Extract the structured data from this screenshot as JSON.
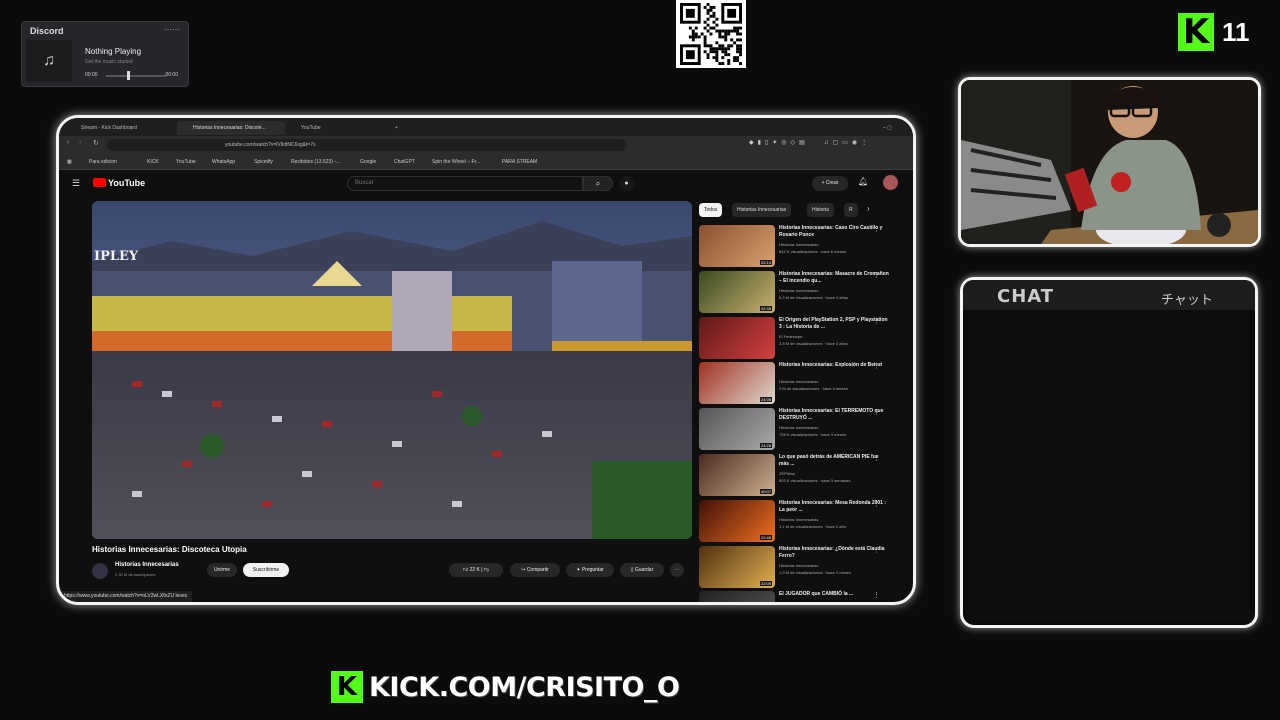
{
  "discord": {
    "title": "Discord",
    "now_playing": "Nothing Playing",
    "subtitle": "Get the music started",
    "time_current": "00:00",
    "time_total": "00:00",
    "progress": 0
  },
  "kick_badge": {
    "letter": "K",
    "count": "11"
  },
  "browser": {
    "tabs": [
      "Stream - Kick Dashboard",
      "Historias Innecesarias: Discote...",
      "YouTube"
    ],
    "url": "youtube.com/watch?v=lVIkttNC6sg&t=7s",
    "bookmarks": [
      "Para edicion",
      "KICK",
      "YouTube",
      "WhatsApp",
      "Spicetify",
      "Recibidos (13.523) -...",
      "Google",
      "ChatGPT",
      "Spin the Wheel – Fr...",
      "PARA STREAM"
    ]
  },
  "youtube": {
    "logo": "YouTube",
    "search_placeholder": "Buscar",
    "create_label": "Crear",
    "video_title": "Historias Innecesarias: Discoteca Utopia",
    "video_overlay_text": "IPLEY",
    "channel_name": "Historias Innecesarias",
    "channel_subs": "2,32 M de suscriptores",
    "join_label": "Unirme",
    "subscribe_label": "Suscribirme",
    "likes": "22 K",
    "share_label": "Compartir",
    "ask_label": "Preguntar",
    "save_label": "Guardar",
    "status_url": "https://www.youtube.com/watch?v=oLV2wLXfoZU",
    "status_suffix": "leses",
    "chips": [
      "Todos",
      "Historias Innecesarias",
      "Historia",
      "R"
    ],
    "recommendations": [
      {
        "title": "Historias Innecesarias: Caso Ciro Castillo y Rosario Ponce",
        "channel": "Historias Innecesarias",
        "views": "842 K visualizaciones · hace 6 meses",
        "duration": "22:14",
        "colors": [
          "#8a5030",
          "#d9a070"
        ]
      },
      {
        "title": "Historias Innecesarias: Masacre de Cromañon – El incendio qu...",
        "channel": "Historias Innecesarias",
        "views": "5,3 M de visualizaciones · hace 4 años",
        "duration": "42:35",
        "colors": [
          "#3a4a20",
          "#c8b070"
        ]
      },
      {
        "title": "El Origen del PlayStation 2, PSP y Playstation 3 : La Historia de ...",
        "channel": "El Fedeslope",
        "views": "2,8 M de visualizaciones · hace 3 años",
        "duration": "",
        "colors": [
          "#601818",
          "#d24040"
        ]
      },
      {
        "title": "Historias Innecesarias: Explosión de Beirut",
        "channel": "Historias Innecesarias",
        "views": "2 M de visualizaciones · hace 4 meses",
        "duration": "24:05",
        "colors": [
          "#a03020",
          "#e0d8d0"
        ]
      },
      {
        "title": "Historias Innecesarias: El TERREMOTO que DESTRUYÓ ...",
        "channel": "Historias Innecesarias",
        "views": "728 K visualizaciones · hace 3 meses",
        "duration": "24:26",
        "colors": [
          "#555",
          "#aaa"
        ]
      },
      {
        "title": "Lo que pasó detrás de AMERICAN PIE fue más ...",
        "channel": "ZEPfilms",
        "views": "503 K visualizaciones · hace 3 semanas",
        "duration": "40:07",
        "colors": [
          "#4a2a20",
          "#d0b090"
        ]
      },
      {
        "title": "Historias Innecesarias: Mesa Redonda 2001 : La peor ...",
        "channel": "Historias Innecesarias",
        "views": "1,1 M de visualizaciones · hace 1 año",
        "duration": "22:46",
        "colors": [
          "#401008",
          "#f07020"
        ]
      },
      {
        "title": "Historias Innecesarias: ¿Dónde está Claudia Ferro?",
        "channel": "Historias Innecesarias",
        "views": "1,9 M de visualizaciones · hace 3 meses",
        "duration": "22:09",
        "colors": [
          "#503010",
          "#e0b050"
        ]
      },
      {
        "title": "El JUGADOR que CAMBIÓ la ...",
        "channel": "",
        "views": "",
        "duration": "",
        "colors": [
          "#222",
          "#555"
        ]
      }
    ]
  },
  "chat": {
    "title": "CHAT",
    "japanese": "チャット"
  },
  "kick_url": {
    "letter": "K",
    "text": "KICK.COM/CRISITO_O"
  }
}
